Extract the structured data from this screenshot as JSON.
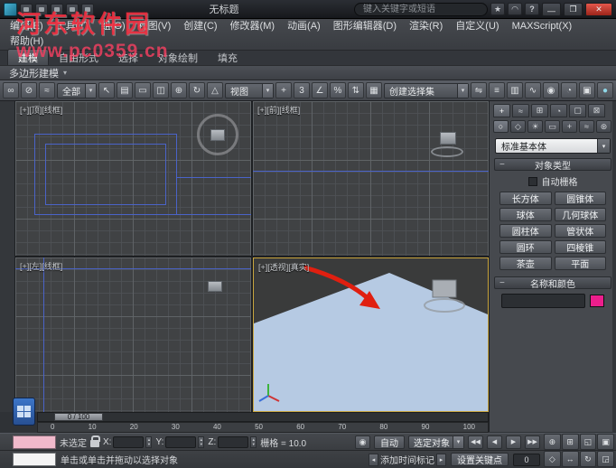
{
  "watermark": {
    "line1": "河东软件园",
    "line2": "www.pc0359.cn"
  },
  "titlebar": {
    "title": "无标题",
    "search_placeholder": "键入关键字或短语"
  },
  "menubar": {
    "items": [
      "编辑(E)",
      "工具(T)",
      "组(G)",
      "视图(V)",
      "创建(C)",
      "修改器(M)",
      "动画(A)",
      "图形编辑器(D)",
      "渲染(R)",
      "自定义(U)",
      "MAXScript(X)",
      "帮助(H)"
    ]
  },
  "ribbon": {
    "tabs": [
      "建模",
      "自由形式",
      "选择",
      "对象绘制",
      "填充"
    ],
    "panel_label": "多边形建模"
  },
  "toolbar": {
    "selection_filter": "全部",
    "coord_system": "视图",
    "named_selection": "创建选择集",
    "snap_3d": "3",
    "angle_snap": "∠",
    "percent_snap": "%"
  },
  "viewports": {
    "top_left_label": "[+][顶][线框]",
    "top_right_label": "[+][前][线框]",
    "bottom_left_label": "[+][左][线框]",
    "perspective_label": "[+][透视][真实]"
  },
  "command_panel": {
    "category_dropdown": "标准基本体",
    "rollout_object_type": "对象类型",
    "autogrid": "自动栅格",
    "object_buttons": [
      "长方体",
      "圆锥体",
      "球体",
      "几何球体",
      "圆柱体",
      "管状体",
      "圆环",
      "四棱锥",
      "茶壶",
      "平面"
    ],
    "rollout_name_color": "名称和颜色",
    "color_swatch": "#ec1e8c"
  },
  "timeline": {
    "slider_label": "0 / 100",
    "ticks": [
      "0",
      "10",
      "20",
      "30",
      "40",
      "50",
      "60",
      "70",
      "80",
      "90",
      "100"
    ]
  },
  "status": {
    "selection": "未选定",
    "x": "X:",
    "y": "Y:",
    "z": "Z:",
    "grid": "栅格 = 10.0",
    "auto_key": "自动",
    "selected_filter": "选定对象",
    "set_key": "设置关键点",
    "frame": "0",
    "prompt": "单击或单击并拖动以选择对象",
    "time_tag": "添加时间标记"
  }
}
